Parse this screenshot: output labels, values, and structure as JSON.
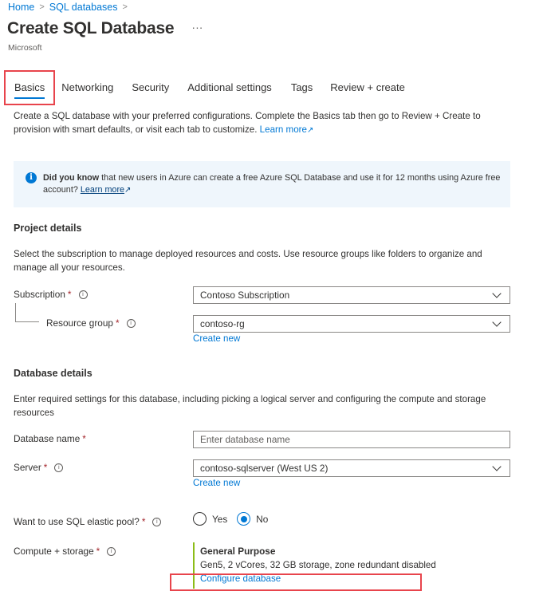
{
  "breadcrumb": [
    {
      "label": "Home"
    },
    {
      "label": "SQL databases"
    }
  ],
  "header": {
    "title": "Create SQL Database",
    "more_label": "···",
    "publisher": "Microsoft"
  },
  "tabs": [
    {
      "label": "Basics",
      "active": true
    },
    {
      "label": "Networking"
    },
    {
      "label": "Security"
    },
    {
      "label": "Additional settings"
    },
    {
      "label": "Tags"
    },
    {
      "label": "Review + create"
    }
  ],
  "intro": {
    "text": "Create a SQL database with your preferred configurations. Complete the Basics tab then go to Review + Create to provision with smart defaults, or visit each tab to customize.",
    "link": "Learn more",
    "link_icon": "external-link-icon"
  },
  "infobox": {
    "icon": "info-icon",
    "bold": "Did you know",
    "text": " that new users in Azure can create a free Azure SQL Database and use it for 12 months using Azure free account? ",
    "link": "Learn more",
    "link_icon": "external-link-icon"
  },
  "project": {
    "title": "Project details",
    "desc": "Select the subscription to manage deployed resources and costs. Use resource groups like folders to organize and manage all your resources.",
    "subscription_label": "Subscription",
    "subscription_value": "Contoso Subscription",
    "resource_group_label": "Resource group",
    "resource_group_value": "contoso-rg",
    "create_new": "Create new"
  },
  "database": {
    "title": "Database details",
    "desc": "Enter required settings for this database, including picking a logical server and configuring the compute and storage resources",
    "name_label": "Database name",
    "name_placeholder": "Enter database name",
    "name_value": "",
    "server_label": "Server",
    "server_value": "contoso-sqlserver (West US 2)",
    "create_new": "Create new",
    "elastic_label": "Want to use SQL elastic pool?",
    "elastic_options": [
      {
        "label": "Yes",
        "checked": false
      },
      {
        "label": "No",
        "checked": true
      }
    ],
    "compute_label": "Compute + storage",
    "compute_tier": "General Purpose",
    "compute_desc": "Gen5, 2 vCores, 32 GB storage, zone redundant disabled",
    "configure_link": "Configure database"
  },
  "common": {
    "required_mark": "*",
    "info_glyph": "i"
  },
  "colors": {
    "accent": "#0078d4",
    "highlight": "#e8444c",
    "required": "#a4262c",
    "compute_bar": "#8cbd18"
  }
}
